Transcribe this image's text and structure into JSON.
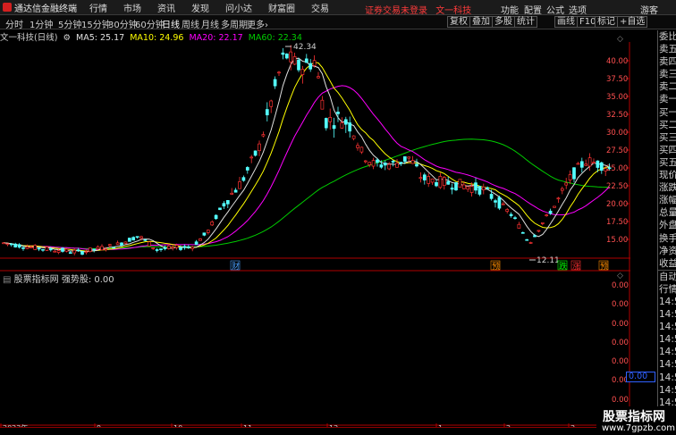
{
  "menu": {
    "app_name": "通达信金融终端",
    "items": [
      "行情",
      "市场",
      "资讯",
      "发现",
      "问小达",
      "财富圈",
      "交易"
    ],
    "notice": "证券交易未登录",
    "stock_name": "文一科技",
    "right_items": [
      "功能",
      "配置",
      "公式",
      "选项"
    ],
    "user": "游客"
  },
  "toolbar": {
    "timeframes": [
      "分时",
      "1分钟",
      "5分钟",
      "15分钟",
      "30分钟",
      "60分钟",
      "日线",
      "周线",
      "月线",
      "多周期",
      "更多"
    ],
    "active_timeframe": "日线",
    "right_buttons": [
      "复权",
      "叠加",
      "多股",
      "统计",
      "画线",
      "F10",
      "标记",
      "+自选"
    ]
  },
  "info": {
    "title": "文一科技(日线)",
    "ma5_label": "MA5: 25.17",
    "ma10_label": "MA10: 24.96",
    "ma20_label": "MA20: 22.17",
    "ma60_label": "MA60: 22.34"
  },
  "price_axis": [
    "40.00",
    "37.50",
    "35.00",
    "32.50",
    "30.00",
    "27.50",
    "25.00",
    "22.50",
    "20.00",
    "17.50",
    "15.00"
  ],
  "indicator_axis": [
    "0.00",
    "0.00",
    "0.00",
    "0.00",
    "0.00",
    "0.00",
    "0.00",
    "0.00"
  ],
  "indicator": {
    "source": "股票指标网",
    "name": "强势股:",
    "value": "0.00",
    "box_value": "0.00"
  },
  "annotations": {
    "high_label": "42.34",
    "low_label": "12.11"
  },
  "event_markers": [
    {
      "text": "财",
      "color": "#4aa0ff"
    },
    {
      "text": "预",
      "color": "#ff8c00"
    },
    {
      "text": "跌",
      "color": "#00ff00"
    },
    {
      "text": "涨",
      "color": "#ff3030"
    },
    {
      "text": "预",
      "color": "#ff8c00"
    }
  ],
  "date_axis": [
    "2023年",
    "9",
    "10",
    "11",
    "12",
    "1",
    "2",
    "3"
  ],
  "side_panel": {
    "top": [
      "委比",
      "卖五",
      "卖四",
      "卖三",
      "卖二",
      "卖一",
      "买一",
      "买二",
      "买三",
      "买四",
      "买五",
      "现价",
      "涨跌",
      "涨幅",
      "总量",
      "外盘",
      "换手",
      "净资",
      "收益"
    ],
    "bottom": [
      "自动",
      "行情",
      "14:5",
      "14:5",
      "14:5",
      "14:5",
      "14:5",
      "14:5",
      "14:5",
      "14:5",
      "14:5",
      "14:5"
    ]
  },
  "watermark": {
    "title": "股票指标网",
    "url": "www.7gpzb.com"
  },
  "colors": {
    "candle_up": "#ff3232",
    "candle_down": "#54ffff",
    "ma5": "#e0e0e0",
    "ma10": "#ffff00",
    "ma20": "#ff00ff",
    "ma60": "#00cc00",
    "axis_border": "#b00000"
  }
}
